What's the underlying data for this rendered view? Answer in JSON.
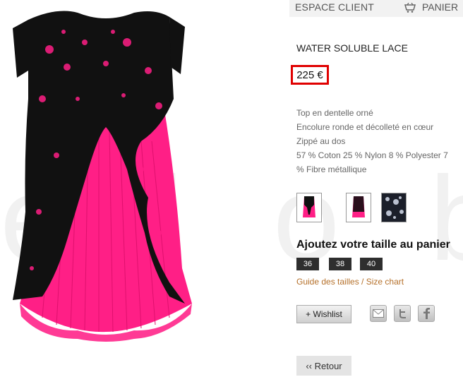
{
  "watermark": "e l o b o",
  "header": {
    "account_label": "ESPACE CLIENT",
    "cart_label": "PANIER"
  },
  "product": {
    "title": "WATER SOLUBLE LACE",
    "price": "225 €",
    "description_lines": [
      "Top en dentelle orné",
      "Encolure ronde et décolleté en cœur",
      "Zippé au dos",
      "57 % Coton 25 % Nylon 8 % Polyester 7",
      "% Fibre métallique"
    ]
  },
  "sizes": {
    "heading": "Ajoutez votre taille au panier",
    "options": [
      "36",
      "38",
      "40"
    ],
    "guide_link": "Guide des tailles / Size chart"
  },
  "actions": {
    "wishlist_label": "+ Wishlist",
    "back_label": "‹‹ Retour"
  },
  "colors": {
    "highlight_border": "#e00000",
    "size_button_bg": "#2e2e2e",
    "link": "#b5702a",
    "dress_pink": "#ff1f86",
    "dress_lace": "#111111"
  }
}
